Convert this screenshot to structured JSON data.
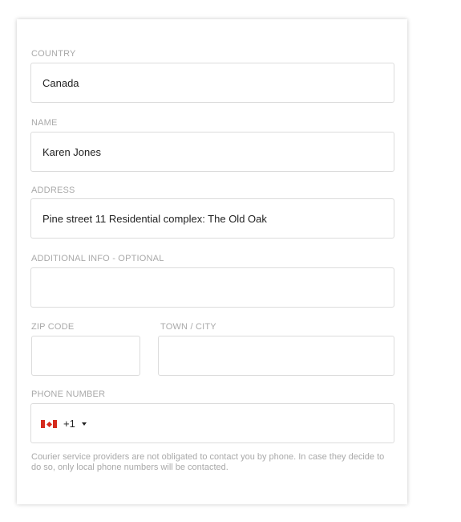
{
  "form": {
    "country": {
      "label": "COUNTRY",
      "value": "Canada"
    },
    "name": {
      "label": "NAME",
      "value": "Karen Jones"
    },
    "address": {
      "label": "ADDRESS",
      "value": "Pine street 11 Residential complex: The Old Oak"
    },
    "additional_info": {
      "label": "ADDITIONAL INFO - OPTIONAL",
      "value": ""
    },
    "zip_code": {
      "label": "ZIP CODE",
      "value": ""
    },
    "town_city": {
      "label": "TOWN / CITY",
      "value": ""
    },
    "phone": {
      "label": "PHONE NUMBER",
      "country_flag": "canada-flag-icon",
      "dial_code": "+1",
      "value": ""
    },
    "help_text": "Courier service providers are not obligated to contact you by phone. In case they decide to do so, only local phone numbers will be contacted."
  },
  "colors": {
    "label": "#a9a9a9",
    "border": "#dcdcdc",
    "text": "#222222",
    "flag_red": "#d52b1e"
  }
}
